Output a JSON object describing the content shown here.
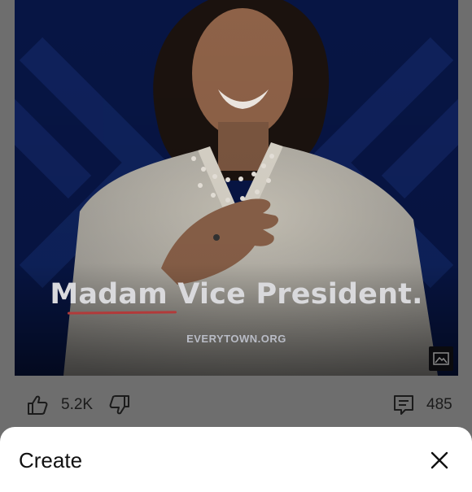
{
  "post": {
    "headline": "Madam Vice President.",
    "site_text": "EVERYTOWN.ORG",
    "image_badge_icon": "image-icon"
  },
  "actions": {
    "like_icon": "thumbs-up-icon",
    "like_count": "5.2K",
    "dislike_icon": "thumbs-down-icon",
    "comment_icon": "comment-icon",
    "comment_count": "485"
  },
  "sheet": {
    "title": "Create",
    "close_icon": "close-icon"
  },
  "colors": {
    "image_bg": "#071544",
    "overlay_dim": "#6e6e6e",
    "accent_underline": "#b23a3a",
    "sheet_bg": "#ffffff"
  }
}
